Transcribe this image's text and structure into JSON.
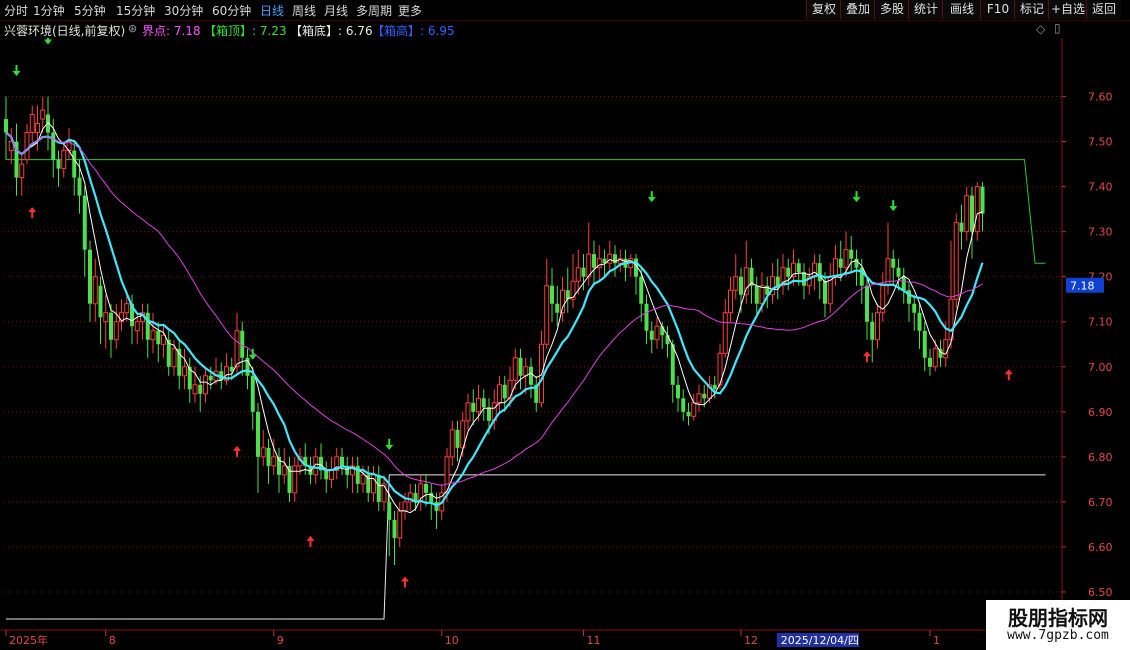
{
  "toolbar": {
    "periods": [
      "分时",
      "1分钟",
      "5分钟",
      "15分钟",
      "30分钟",
      "60分钟",
      "日线",
      "周线",
      "月线",
      "多周期",
      "更多"
    ],
    "active_period": "日线",
    "buttons": [
      "复权",
      "叠加",
      "多股",
      "统计",
      "画线",
      "F10",
      "标记",
      "+自选",
      "返回"
    ]
  },
  "infobar": {
    "stock_title": "兴蓉环境(日线,前复权)",
    "jiedian": "界点: 7.18",
    "xiangding": "【箱顶】: 7.23",
    "xiangdi": "【箱底】: 6.76",
    "xianggao": "【箱高】: 6.95"
  },
  "watermark": {
    "line1": "股朋指标网",
    "line2": "www.7gpzb.com"
  },
  "chart_data": {
    "type": "candlestick",
    "title": "兴蓉环境(日线,前复权)",
    "y_ticks": [
      6.5,
      6.6,
      6.7,
      6.8,
      6.9,
      7.0,
      7.1,
      7.2,
      7.3,
      7.4,
      7.5,
      7.6
    ],
    "ylim": [
      6.42,
      7.73
    ],
    "x_labels": [
      {
        "label": "2025年",
        "index": 0
      },
      {
        "label": "8",
        "index": 19
      },
      {
        "label": "9",
        "index": 51
      },
      {
        "label": "10",
        "index": 83
      },
      {
        "label": "11",
        "index": 110
      },
      {
        "label": "12",
        "index": 140
      },
      {
        "label": "2025/12/04/四",
        "index": 143,
        "cursor": true
      },
      {
        "label": "1",
        "index": 176
      }
    ],
    "current_price_label": "7.18",
    "levels": {
      "jiedian": 7.18,
      "xiangding": 7.23,
      "xiangdi": 6.76,
      "xianggao": 6.95
    },
    "box_lines": [
      {
        "color": "#22cc22",
        "points": [
          [
            0,
            7.46
          ],
          [
            194,
            7.46
          ],
          [
            196,
            7.23
          ],
          [
            198,
            7.23
          ]
        ]
      },
      {
        "color": "#e8e8e8",
        "points": [
          [
            0,
            6.44
          ],
          [
            72,
            6.44
          ],
          [
            73,
            6.76
          ],
          [
            198,
            6.76
          ]
        ]
      }
    ],
    "down_arrows": [
      {
        "i": 2,
        "v": 7.65
      },
      {
        "i": 8,
        "v": 7.72
      },
      {
        "i": 47,
        "v": 7.02
      },
      {
        "i": 73,
        "v": 6.82
      },
      {
        "i": 123,
        "v": 7.37
      },
      {
        "i": 162,
        "v": 7.37
      },
      {
        "i": 169,
        "v": 7.35
      }
    ],
    "up_arrows": [
      {
        "i": 5,
        "v": 7.35
      },
      {
        "i": 44,
        "v": 6.82
      },
      {
        "i": 58,
        "v": 6.62
      },
      {
        "i": 76,
        "v": 6.53
      },
      {
        "i": 164,
        "v": 7.03
      },
      {
        "i": 191,
        "v": 6.99
      }
    ],
    "candles": [
      [
        7.55,
        7.52,
        7.6,
        7.46
      ],
      [
        7.48,
        7.5,
        7.53,
        7.45
      ],
      [
        7.5,
        7.42,
        7.54,
        7.38
      ],
      [
        7.42,
        7.45,
        7.47,
        7.38
      ],
      [
        7.46,
        7.52,
        7.54,
        7.45
      ],
      [
        7.52,
        7.56,
        7.58,
        7.5
      ],
      [
        7.52,
        7.54,
        7.58,
        7.48
      ],
      [
        7.55,
        7.57,
        7.6,
        7.52
      ],
      [
        7.56,
        7.52,
        7.6,
        7.48
      ],
      [
        7.52,
        7.46,
        7.55,
        7.42
      ],
      [
        7.46,
        7.44,
        7.48,
        7.4
      ],
      [
        7.44,
        7.48,
        7.5,
        7.42
      ],
      [
        7.48,
        7.5,
        7.53,
        7.46
      ],
      [
        7.48,
        7.42,
        7.5,
        7.38
      ],
      [
        7.42,
        7.38,
        7.46,
        7.34
      ],
      [
        7.38,
        7.26,
        7.4,
        7.2
      ],
      [
        7.26,
        7.14,
        7.28,
        7.1
      ],
      [
        7.14,
        7.2,
        7.24,
        7.1
      ],
      [
        7.18,
        7.11,
        7.2,
        7.05
      ],
      [
        7.1,
        7.12,
        7.16,
        7.04
      ],
      [
        7.12,
        7.06,
        7.14,
        7.02
      ],
      [
        7.06,
        7.1,
        7.14,
        7.04
      ],
      [
        7.1,
        7.12,
        7.15,
        7.08
      ],
      [
        7.12,
        7.14,
        7.16,
        7.1
      ],
      [
        7.14,
        7.09,
        7.16,
        7.05
      ],
      [
        7.08,
        7.1,
        7.12,
        7.05
      ],
      [
        7.1,
        7.12,
        7.14,
        7.06
      ],
      [
        7.12,
        7.06,
        7.14,
        7.02
      ],
      [
        7.06,
        7.08,
        7.12,
        7.03
      ],
      [
        7.08,
        7.05,
        7.1,
        7.01
      ],
      [
        7.05,
        7.07,
        7.09,
        7.02
      ],
      [
        7.06,
        7.0,
        7.08,
        6.98
      ],
      [
        7.0,
        7.04,
        7.06,
        6.98
      ],
      [
        7.04,
        6.98,
        7.06,
        6.95
      ],
      [
        6.98,
        7.0,
        7.04,
        6.95
      ],
      [
        7.0,
        6.95,
        7.02,
        6.92
      ],
      [
        6.94,
        6.96,
        7.0,
        6.92
      ],
      [
        6.96,
        6.94,
        6.98,
        6.9
      ],
      [
        6.94,
        6.98,
        7.0,
        6.92
      ],
      [
        6.98,
        6.97,
        7.0,
        6.95
      ],
      [
        6.97,
        6.99,
        7.02,
        6.96
      ],
      [
        6.99,
        6.97,
        7.01,
        6.95
      ],
      [
        6.97,
        7.0,
        7.03,
        6.96
      ],
      [
        7.0,
        6.99,
        7.02,
        6.97
      ],
      [
        7.0,
        7.08,
        7.12,
        6.98
      ],
      [
        7.08,
        7.02,
        7.1,
        6.98
      ],
      [
        7.02,
        6.98,
        7.04,
        6.95
      ],
      [
        6.98,
        6.9,
        7.0,
        6.86
      ],
      [
        6.9,
        6.8,
        6.92,
        6.72
      ],
      [
        6.8,
        6.82,
        6.86,
        6.78
      ],
      [
        6.82,
        6.78,
        6.84,
        6.74
      ],
      [
        6.78,
        6.8,
        6.84,
        6.76
      ],
      [
        6.8,
        6.76,
        6.82,
        6.72
      ],
      [
        6.76,
        6.78,
        6.82,
        6.74
      ],
      [
        6.78,
        6.72,
        6.8,
        6.7
      ],
      [
        6.72,
        6.78,
        6.8,
        6.7
      ],
      [
        6.78,
        6.8,
        6.82,
        6.76
      ],
      [
        6.8,
        6.78,
        6.83,
        6.76
      ],
      [
        6.78,
        6.76,
        6.8,
        6.74
      ],
      [
        6.76,
        6.8,
        6.82,
        6.74
      ],
      [
        6.8,
        6.77,
        6.83,
        6.75
      ],
      [
        6.77,
        6.75,
        6.79,
        6.72
      ],
      [
        6.75,
        6.77,
        6.8,
        6.73
      ],
      [
        6.77,
        6.8,
        6.82,
        6.75
      ],
      [
        6.8,
        6.78,
        6.82,
        6.76
      ],
      [
        6.78,
        6.76,
        6.8,
        6.73
      ],
      [
        6.76,
        6.78,
        6.8,
        6.72
      ],
      [
        6.78,
        6.74,
        6.8,
        6.72
      ],
      [
        6.74,
        6.76,
        6.78,
        6.72
      ],
      [
        6.76,
        6.72,
        6.78,
        6.7
      ],
      [
        6.72,
        6.76,
        6.78,
        6.7
      ],
      [
        6.76,
        6.7,
        6.78,
        6.68
      ],
      [
        6.7,
        6.74,
        6.76,
        6.68
      ],
      [
        6.7,
        6.66,
        6.72,
        6.58
      ],
      [
        6.66,
        6.62,
        6.68,
        6.56
      ],
      [
        6.62,
        6.68,
        6.7,
        6.6
      ],
      [
        6.68,
        6.7,
        6.72,
        6.66
      ],
      [
        6.7,
        6.72,
        6.74,
        6.68
      ],
      [
        6.72,
        6.7,
        6.74,
        6.68
      ],
      [
        6.7,
        6.74,
        6.76,
        6.68
      ],
      [
        6.74,
        6.72,
        6.76,
        6.69
      ],
      [
        6.72,
        6.7,
        6.74,
        6.66
      ],
      [
        6.7,
        6.68,
        6.72,
        6.64
      ],
      [
        6.68,
        6.72,
        6.74,
        6.66
      ],
      [
        6.72,
        6.8,
        6.82,
        6.7
      ],
      [
        6.8,
        6.86,
        6.88,
        6.78
      ],
      [
        6.86,
        6.82,
        6.88,
        6.79
      ],
      [
        6.82,
        6.88,
        6.9,
        6.8
      ],
      [
        6.88,
        6.92,
        6.94,
        6.86
      ],
      [
        6.92,
        6.9,
        6.95,
        6.87
      ],
      [
        6.9,
        6.93,
        6.96,
        6.88
      ],
      [
        6.93,
        6.91,
        6.95,
        6.88
      ],
      [
        6.91,
        6.88,
        6.93,
        6.85
      ],
      [
        6.88,
        6.92,
        6.95,
        6.86
      ],
      [
        6.92,
        6.96,
        6.98,
        6.9
      ],
      [
        6.96,
        6.93,
        6.98,
        6.9
      ],
      [
        6.93,
        6.97,
        7.0,
        6.91
      ],
      [
        6.97,
        7.02,
        7.04,
        6.95
      ],
      [
        7.02,
        6.98,
        7.04,
        6.95
      ],
      [
        6.98,
        7.0,
        7.02,
        6.94
      ],
      [
        7.0,
        6.96,
        7.02,
        6.93
      ],
      [
        6.96,
        6.92,
        6.98,
        6.9
      ],
      [
        6.92,
        7.05,
        7.08,
        6.91
      ],
      [
        7.05,
        7.18,
        7.24,
        7.04
      ],
      [
        7.18,
        7.14,
        7.22,
        7.1
      ],
      [
        7.14,
        7.12,
        7.18,
        7.09
      ],
      [
        7.12,
        7.17,
        7.2,
        7.1
      ],
      [
        7.17,
        7.15,
        7.22,
        7.12
      ],
      [
        7.15,
        7.19,
        7.25,
        7.13
      ],
      [
        7.19,
        7.22,
        7.26,
        7.16
      ],
      [
        7.22,
        7.2,
        7.25,
        7.17
      ],
      [
        7.2,
        7.25,
        7.32,
        7.18
      ],
      [
        7.25,
        7.22,
        7.28,
        7.18
      ],
      [
        7.22,
        7.24,
        7.27,
        7.19
      ],
      [
        7.24,
        7.23,
        7.26,
        7.2
      ],
      [
        7.23,
        7.25,
        7.28,
        7.21
      ],
      [
        7.25,
        7.23,
        7.27,
        7.2
      ],
      [
        7.23,
        7.24,
        7.26,
        7.21
      ],
      [
        7.24,
        7.22,
        7.26,
        7.19
      ],
      [
        7.22,
        7.24,
        7.25,
        7.2
      ],
      [
        7.24,
        7.2,
        7.25,
        7.16
      ],
      [
        7.2,
        7.14,
        7.22,
        7.1
      ],
      [
        7.14,
        7.08,
        7.16,
        7.05
      ],
      [
        7.08,
        7.06,
        7.1,
        7.03
      ],
      [
        7.06,
        7.09,
        7.11,
        7.04
      ],
      [
        7.09,
        7.07,
        7.1,
        7.04
      ],
      [
        7.07,
        7.05,
        7.09,
        7.02
      ],
      [
        7.05,
        6.96,
        7.06,
        6.92
      ],
      [
        6.96,
        6.93,
        6.98,
        6.9
      ],
      [
        6.93,
        6.9,
        6.95,
        6.88
      ],
      [
        6.9,
        6.89,
        6.92,
        6.87
      ],
      [
        6.89,
        6.92,
        6.94,
        6.88
      ],
      [
        6.92,
        6.94,
        6.96,
        6.9
      ],
      [
        6.94,
        6.93,
        6.96,
        6.91
      ],
      [
        6.93,
        6.96,
        6.98,
        6.92
      ],
      [
        6.96,
        6.95,
        6.98,
        6.93
      ],
      [
        6.96,
        7.03,
        7.05,
        6.95
      ],
      [
        7.03,
        7.12,
        7.15,
        7.02
      ],
      [
        7.12,
        7.17,
        7.2,
        7.1
      ],
      [
        7.17,
        7.2,
        7.25,
        7.15
      ],
      [
        7.2,
        7.16,
        7.22,
        7.12
      ],
      [
        7.16,
        7.22,
        7.28,
        7.14
      ],
      [
        7.22,
        7.18,
        7.24,
        7.14
      ],
      [
        7.18,
        7.14,
        7.2,
        7.11
      ],
      [
        7.14,
        7.18,
        7.21,
        7.12
      ],
      [
        7.18,
        7.16,
        7.2,
        7.13
      ],
      [
        7.16,
        7.2,
        7.23,
        7.14
      ],
      [
        7.2,
        7.18,
        7.24,
        7.15
      ],
      [
        7.18,
        7.22,
        7.25,
        7.16
      ],
      [
        7.22,
        7.2,
        7.24,
        7.17
      ],
      [
        7.2,
        7.23,
        7.26,
        7.18
      ],
      [
        7.23,
        7.21,
        7.24,
        7.18
      ],
      [
        7.21,
        7.18,
        7.23,
        7.15
      ],
      [
        7.18,
        7.2,
        7.22,
        7.16
      ],
      [
        7.2,
        7.23,
        7.25,
        7.17
      ],
      [
        7.23,
        7.19,
        7.25,
        7.15
      ],
      [
        7.19,
        7.14,
        7.21,
        7.11
      ],
      [
        7.14,
        7.2,
        7.23,
        7.12
      ],
      [
        7.2,
        7.24,
        7.27,
        7.18
      ],
      [
        7.24,
        7.22,
        7.28,
        7.19
      ],
      [
        7.22,
        7.26,
        7.3,
        7.2
      ],
      [
        7.26,
        7.24,
        7.29,
        7.21
      ],
      [
        7.24,
        7.22,
        7.26,
        7.18
      ],
      [
        7.22,
        7.18,
        7.24,
        7.14
      ],
      [
        7.18,
        7.1,
        7.2,
        7.06
      ],
      [
        7.1,
        7.06,
        7.12,
        7.01
      ],
      [
        7.06,
        7.12,
        7.14,
        7.04
      ],
      [
        7.12,
        7.18,
        7.21,
        7.1
      ],
      [
        7.18,
        7.24,
        7.32,
        7.16
      ],
      [
        7.24,
        7.22,
        7.26,
        7.18
      ],
      [
        7.22,
        7.2,
        7.24,
        7.17
      ],
      [
        7.2,
        7.17,
        7.22,
        7.14
      ],
      [
        7.17,
        7.14,
        7.19,
        7.1
      ],
      [
        7.14,
        7.12,
        7.16,
        7.08
      ],
      [
        7.12,
        7.08,
        7.14,
        7.04
      ],
      [
        7.08,
        7.02,
        7.1,
        6.99
      ],
      [
        7.02,
        7.0,
        7.04,
        6.98
      ],
      [
        7.0,
        7.04,
        7.06,
        6.99
      ],
      [
        7.04,
        7.02,
        7.06,
        7.0
      ],
      [
        7.02,
        7.06,
        7.1,
        7.0
      ],
      [
        7.06,
        7.15,
        7.28,
        7.04
      ],
      [
        7.15,
        7.32,
        7.34,
        7.13
      ],
      [
        7.32,
        7.3,
        7.36,
        7.26
      ],
      [
        7.3,
        7.38,
        7.4,
        7.28
      ],
      [
        7.38,
        7.3,
        7.4,
        7.24
      ],
      [
        7.3,
        7.4,
        7.41,
        7.28
      ],
      [
        7.4,
        7.34,
        7.41,
        7.3
      ]
    ],
    "ma_series": [
      {
        "period": 5,
        "color": "#ffffff"
      },
      {
        "period": 10,
        "color": "#3ee8ff"
      },
      {
        "period": 30,
        "color": "#e040e0"
      }
    ]
  }
}
